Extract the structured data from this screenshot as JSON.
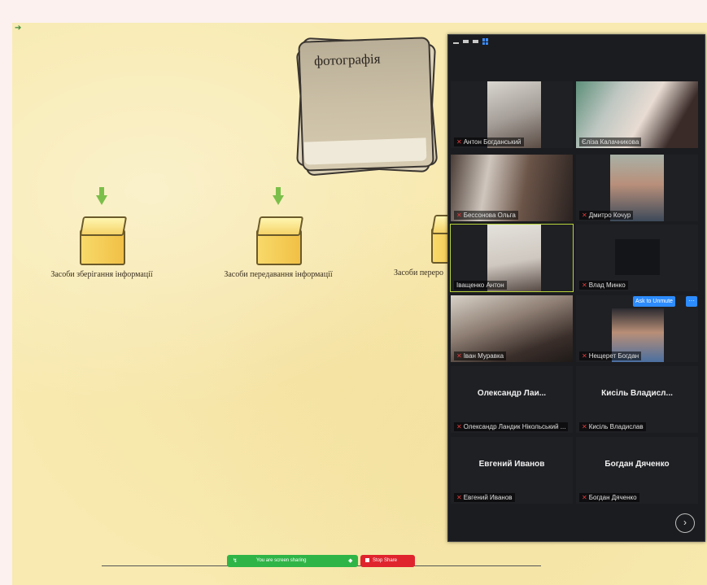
{
  "slide": {
    "card_title": "фотографія",
    "nodes": [
      {
        "label": "Засоби зберігання інформації"
      },
      {
        "label": "Засоби передавання інформації"
      },
      {
        "label": "Засоби переро"
      }
    ]
  },
  "zoom": {
    "participants": [
      {
        "name": "Антон Богданський",
        "video": "on"
      },
      {
        "name": "Єліза Калачникова",
        "video": "on"
      },
      {
        "name": "Бессонова Ольга",
        "video": "on"
      },
      {
        "name": "Дмитро Кочур",
        "video": "on"
      },
      {
        "name": "Іващенко Антон",
        "video": "on"
      },
      {
        "name": "Влад Минко",
        "video": "on"
      },
      {
        "name": "Іван Муравка",
        "video": "on"
      },
      {
        "name": "Нещерет Богдан",
        "video": "on"
      },
      {
        "display": "Олександр Лаи...",
        "name": "Олександр Ландик Нікольський ...",
        "video": "off"
      },
      {
        "display": "Кисіль Владисл...",
        "name": "Кисіль Владислав",
        "video": "off"
      },
      {
        "display": "Евгений Иванов",
        "name": "Евгений Иванов",
        "video": "off"
      },
      {
        "display": "Богдан Дяченко",
        "name": "Богдан Дяченко",
        "video": "off"
      }
    ],
    "donate_label": "Ask to Unmute",
    "more_label": "···",
    "next_icon": "chevron-right-icon"
  },
  "share": {
    "status_text": "You are screen sharing",
    "stop_label": "Stop Share"
  },
  "colors": {
    "accent": "#2d8cff",
    "share_green": "#2fb547",
    "stop_red": "#e0242e",
    "slide_bg": "#f8eab0"
  }
}
